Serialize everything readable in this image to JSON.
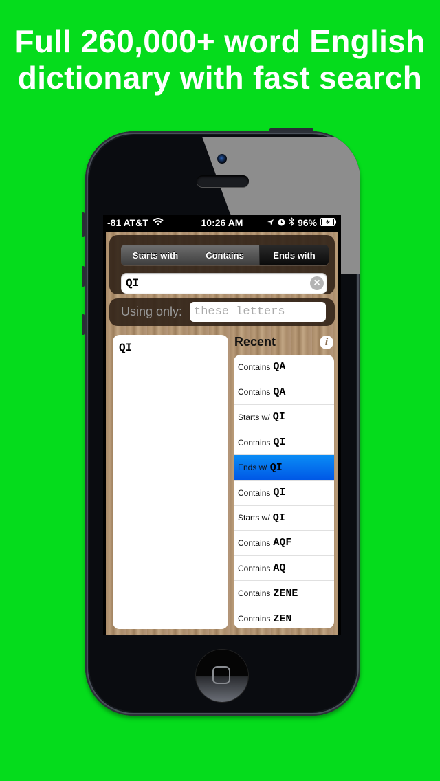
{
  "headline": {
    "line1": "Full 260,000+ word English",
    "line2": "dictionary with fast search"
  },
  "status_bar": {
    "carrier": "-81 AT&T",
    "wifi_icon": "wifi-icon",
    "time": "10:26 AM",
    "location_icon": "location-arrow-icon",
    "alarm_icon": "clock-icon",
    "bluetooth_icon": "bluetooth-icon",
    "battery_percent": "96%",
    "battery_icon": "battery-charging-icon"
  },
  "search_mode": {
    "segments": [
      {
        "label": "Starts with",
        "active": false
      },
      {
        "label": "Contains",
        "active": false
      },
      {
        "label": "Ends with",
        "active": true
      }
    ]
  },
  "search": {
    "value": "QI",
    "clear_icon": "clear-icon"
  },
  "filter": {
    "label": "Using only:",
    "placeholder": "these letters",
    "value": ""
  },
  "results": {
    "words": [
      "QI"
    ]
  },
  "recent": {
    "title": "Recent",
    "info_icon": "info-icon",
    "items": [
      {
        "kind": "Contains",
        "term": "QA",
        "selected": false
      },
      {
        "kind": "Contains",
        "term": "QA",
        "selected": false
      },
      {
        "kind": "Starts w/",
        "term": "QI",
        "selected": false
      },
      {
        "kind": "Contains",
        "term": "QI",
        "selected": false
      },
      {
        "kind": "Ends w/",
        "term": "QI",
        "selected": true
      },
      {
        "kind": "Contains",
        "term": "QI",
        "selected": false
      },
      {
        "kind": "Starts w/",
        "term": "QI",
        "selected": false
      },
      {
        "kind": "Contains",
        "term": "AQF",
        "selected": false
      },
      {
        "kind": "Contains",
        "term": "AQ",
        "selected": false
      },
      {
        "kind": "Contains",
        "term": "ZENE",
        "selected": false
      },
      {
        "kind": "Contains",
        "term": "ZEN",
        "selected": false
      }
    ]
  },
  "colors": {
    "background": "#05dc1c",
    "selected_row": "#0a72f0"
  }
}
